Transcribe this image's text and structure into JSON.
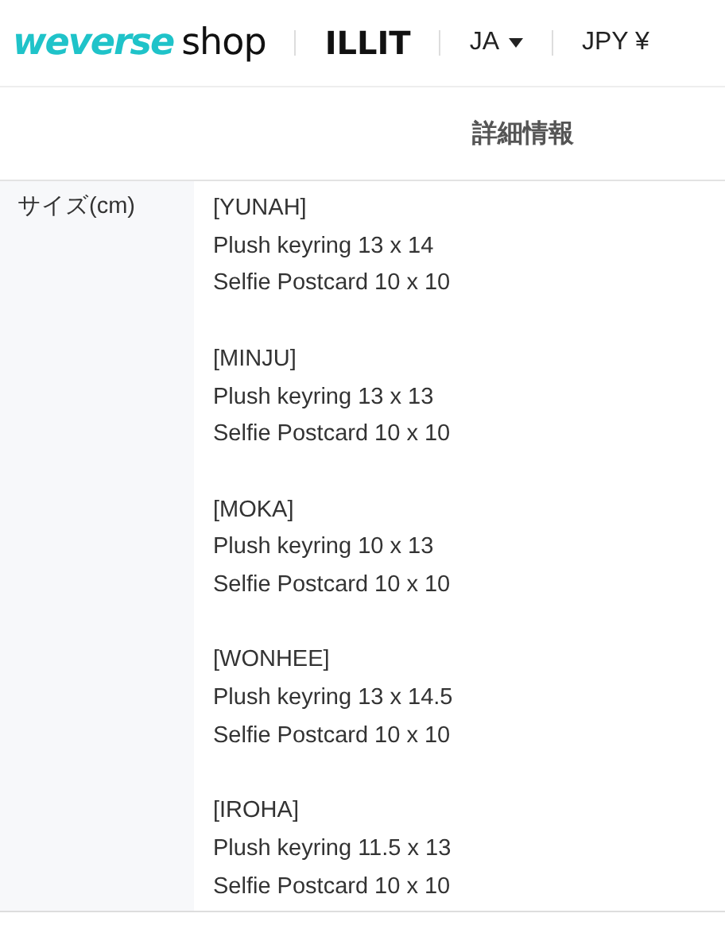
{
  "header": {
    "logo_brand": "weverse",
    "logo_suffix": "shop",
    "artist": "ILLIT",
    "language": "JA",
    "currency": "JPY ¥"
  },
  "section_title": "詳細情報",
  "spec_rows": [
    {
      "label": "サイズ(cm)",
      "groups": [
        {
          "member": "[YUNAH]",
          "lines": [
            "Plush keyring 13 x 14",
            "Selfie Postcard 10 x 10"
          ]
        },
        {
          "member": "[MINJU]",
          "lines": [
            "Plush keyring 13 x 13",
            "Selfie Postcard 10 x 10"
          ]
        },
        {
          "member": "[MOKA]",
          "lines": [
            "Plush keyring 10 x 13",
            "Selfie Postcard 10 x 10"
          ]
        },
        {
          "member": "[WONHEE]",
          "lines": [
            "Plush keyring 13 x 14.5",
            "Selfie Postcard 10 x 10"
          ]
        },
        {
          "member": "[IROHA]",
          "lines": [
            "Plush keyring 11.5 x 13",
            "Selfie Postcard 10 x 10"
          ]
        }
      ]
    }
  ]
}
